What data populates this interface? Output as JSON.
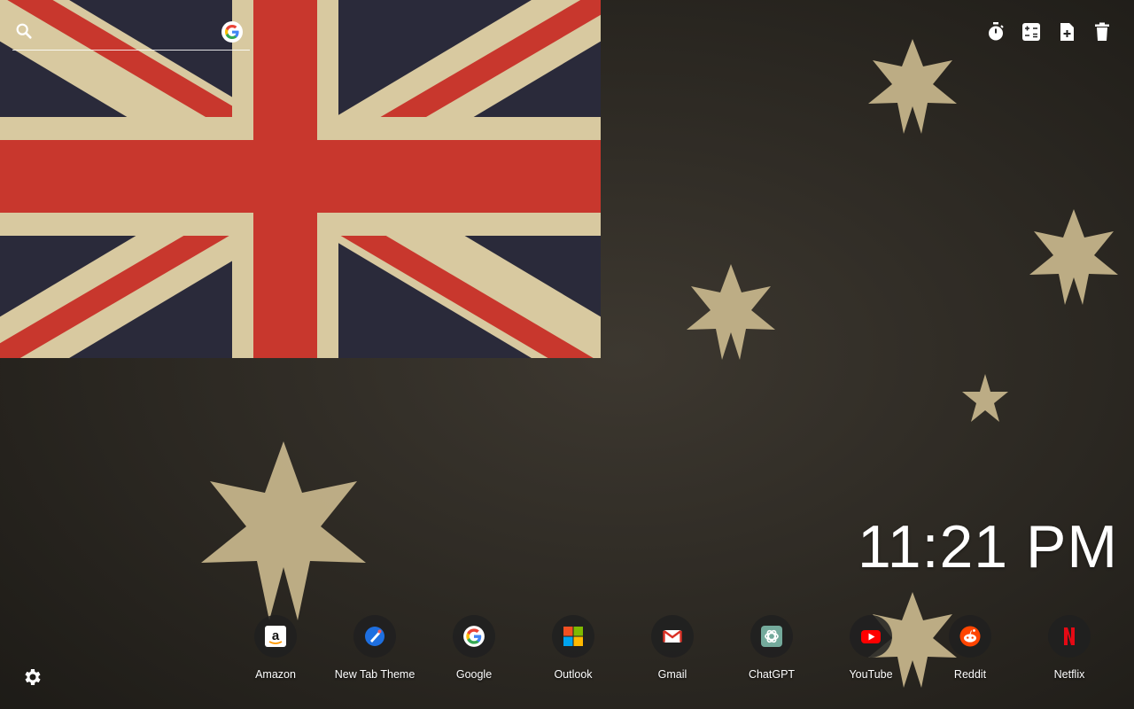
{
  "search": {
    "placeholder": "",
    "icon": "search-icon",
    "engine_icon": "google-icon"
  },
  "toolbar": [
    {
      "icon": "stopwatch-icon"
    },
    {
      "icon": "calculator-icon"
    },
    {
      "icon": "add-note-icon"
    },
    {
      "icon": "trash-icon"
    }
  ],
  "clock": {
    "time": "11:21 PM"
  },
  "settings": {
    "icon": "gear-icon"
  },
  "shortcuts": [
    {
      "label": "Amazon",
      "icon": "amazon-icon"
    },
    {
      "label": "New Tab Theme",
      "icon": "new-tab-theme-icon"
    },
    {
      "label": "Google",
      "icon": "google-icon"
    },
    {
      "label": "Outlook",
      "icon": "microsoft-icon"
    },
    {
      "label": "Gmail",
      "icon": "gmail-icon"
    },
    {
      "label": "ChatGPT",
      "icon": "chatgpt-icon"
    },
    {
      "label": "YouTube",
      "icon": "youtube-icon"
    },
    {
      "label": "Reddit",
      "icon": "reddit-icon"
    },
    {
      "label": "Netflix",
      "icon": "netflix-icon"
    }
  ],
  "colors": {
    "flag_red": "#c8372d",
    "flag_cream": "#d8c9a0",
    "background": "#2a2620",
    "star": "#c9b78d"
  }
}
